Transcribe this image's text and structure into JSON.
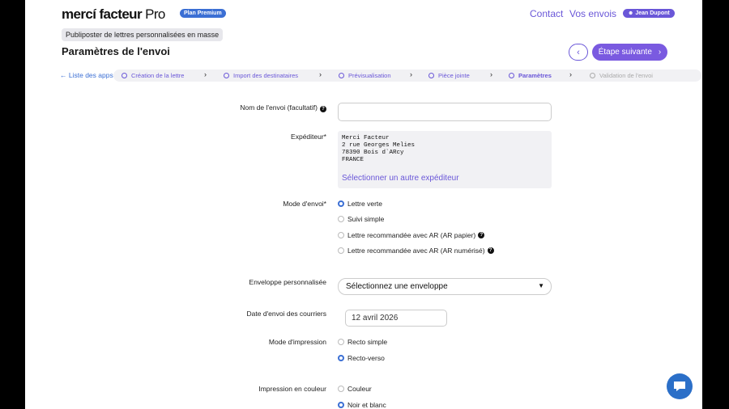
{
  "header": {
    "logo_main": "mercí facteur",
    "logo_pro": " Pro",
    "plan_badge": "Plan Premium",
    "nav_contact": "Contact",
    "nav_envois": "Vos envois",
    "user_name": "Jean Dupont"
  },
  "app_badge": "Publiposter de lettres personnalisées en masse",
  "page_title": "Paramètres de l'envoi",
  "actions": {
    "back_icon": "chevron-left",
    "next_label": "Étape suivante",
    "next_icon": "chevron-right"
  },
  "stepper": {
    "back_label": "Liste des apps",
    "steps": [
      {
        "label": "Création de la lettre",
        "state": "done"
      },
      {
        "label": "Import des destinataires",
        "state": "done"
      },
      {
        "label": "Prévisualisation",
        "state": "done"
      },
      {
        "label": "Pièce jointe",
        "state": "done"
      },
      {
        "label": "Paramètres",
        "state": "active"
      },
      {
        "label": "Validation de l'envoi",
        "state": "disabled"
      }
    ]
  },
  "form": {
    "name_label": "Nom de l'envoi (facultatif)",
    "name_value": "",
    "sender_label": "Expéditeur*",
    "sender_lines": [
      "Merci Facteur",
      "2 rue Georges Melies",
      "78390 Bois d`ARcy",
      "FRANCE"
    ],
    "sender_link": "Sélectionner un autre expéditeur",
    "mode_label": "Mode d'envoi*",
    "mode_options": [
      {
        "label": "Lettre verte",
        "selected": true,
        "help": false
      },
      {
        "label": "Suivi simple",
        "selected": false,
        "help": false
      },
      {
        "label": "Lettre recommandée avec AR (AR papier)",
        "selected": false,
        "help": true
      },
      {
        "label": "Lettre recommandée avec AR (AR numérisé)",
        "selected": false,
        "help": true
      }
    ],
    "envelope_label": "Enveloppe personnalisée",
    "envelope_value": "Sélectionnez une enveloppe",
    "date_label": "Date d'envoi des courriers",
    "date_value": "12 avril 2026",
    "print_label": "Mode d'impression",
    "print_options": [
      {
        "label": "Recto simple",
        "selected": false
      },
      {
        "label": "Recto-verso",
        "selected": true
      }
    ],
    "color_label": "Impression en couleur",
    "color_options": [
      {
        "label": "Couleur",
        "selected": false
      },
      {
        "label": "Noir et blanc",
        "selected": true
      }
    ]
  },
  "colors": {
    "accent": "#6a57d8",
    "blue": "#3b6fd4",
    "chat": "#2b6fc8"
  }
}
